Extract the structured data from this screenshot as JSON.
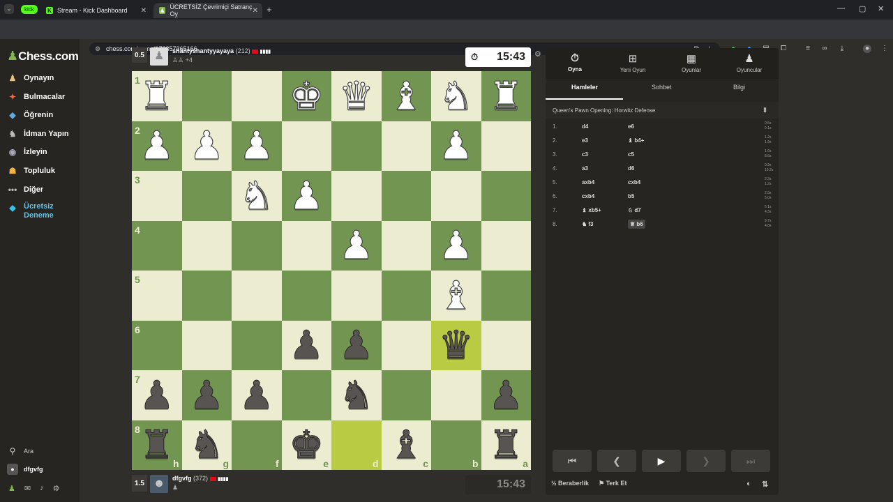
{
  "browser": {
    "tabs": [
      {
        "label": "Stream - Kick Dashboard",
        "badge": "kick",
        "active": false
      },
      {
        "label": "ÜCRETSİZ Çevrimiçi Satranç Oy",
        "active": true
      }
    ],
    "url": "chess.com/game/172357365166"
  },
  "sidebar": {
    "logo": "Chess.com",
    "items": [
      {
        "label": "Oynayın",
        "icon": "play-icon"
      },
      {
        "label": "Bulmacalar",
        "icon": "puzzle-icon"
      },
      {
        "label": "Öğrenin",
        "icon": "learn-icon"
      },
      {
        "label": "İdman Yapın",
        "icon": "train-icon"
      },
      {
        "label": "İzleyin",
        "icon": "watch-icon"
      },
      {
        "label": "Topluluk",
        "icon": "community-icon"
      },
      {
        "label": "Diğer",
        "icon": "more-icon"
      },
      {
        "label": "Ücretsiz Deneme",
        "icon": "diamond-icon"
      }
    ],
    "search_label": "Ara",
    "user_label": "dfgvfg"
  },
  "top_player": {
    "score": "0.5",
    "name": "shantyshantyyayaya",
    "rating": "(212)",
    "captured": "+4",
    "clock": "15:43"
  },
  "bottom_player": {
    "score": "1.5",
    "name": "dfgvfg",
    "rating": "(372)",
    "clock": "15:43"
  },
  "board": {
    "ranks": [
      "1",
      "2",
      "3",
      "4",
      "5",
      "6",
      "7",
      "8"
    ],
    "files": [
      "h",
      "g",
      "f",
      "e",
      "d",
      "c",
      "b",
      "a"
    ],
    "rows": [
      [
        "wR",
        "",
        "",
        "wK",
        "wQ",
        "wB",
        "wN",
        "wR"
      ],
      [
        "wP",
        "wP",
        "wP",
        "",
        "",
        "",
        "wP",
        ""
      ],
      [
        "",
        "",
        "wN",
        "wP",
        "",
        "",
        "",
        ""
      ],
      [
        "",
        "",
        "",
        "",
        "wP",
        "",
        "wP",
        ""
      ],
      [
        "",
        "",
        "",
        "",
        "",
        "",
        "wB",
        ""
      ],
      [
        "",
        "",
        "",
        "bP",
        "bP",
        "",
        "bQ",
        ""
      ],
      [
        "bP",
        "bP",
        "bP",
        "",
        "bN",
        "",
        "",
        "bP"
      ],
      [
        "bR",
        "bN",
        "",
        "bK",
        "",
        "bB",
        "",
        "bR"
      ]
    ],
    "highlights": [
      [
        5,
        6
      ],
      [
        7,
        4
      ]
    ]
  },
  "panel": {
    "tabs": [
      "Oyna",
      "Yeni Oyun",
      "Oyunlar",
      "Oyuncular"
    ],
    "subtabs": [
      "Hamleler",
      "Sohbet",
      "Bilgi"
    ],
    "opening": "Queen's Pawn Opening: Horwitz Defense",
    "moves": [
      {
        "n": "1.",
        "w": "d4",
        "b": "e6",
        "tw": "0.5s",
        "tb": "0.1s"
      },
      {
        "n": "2.",
        "w": "e3",
        "b": "♝ b4+",
        "tw": "1.2s",
        "tb": "1.9s"
      },
      {
        "n": "3.",
        "w": "c3",
        "b": "c5",
        "tw": "1.6s",
        "tb": "8.6s"
      },
      {
        "n": "4.",
        "w": "a3",
        "b": "d6",
        "tw": "0.9s",
        "tb": "10.2s"
      },
      {
        "n": "5.",
        "w": "axb4",
        "b": "cxb4",
        "tw": "2.2s",
        "tb": "1.2s"
      },
      {
        "n": "6.",
        "w": "cxb4",
        "b": "b5",
        "tw": "2.9s",
        "tb": "5.0s"
      },
      {
        "n": "7.",
        "w": "♝ xb5+",
        "b": "♘ d7",
        "tw": "5.1s",
        "tb": "4.3s"
      },
      {
        "n": "8.",
        "w": "♞ f3",
        "b": "♕ b6",
        "tw": "9.7s",
        "tb": "4.8s"
      }
    ],
    "draw_label": "½ Beraberlik",
    "resign_label": "Terk Et"
  }
}
